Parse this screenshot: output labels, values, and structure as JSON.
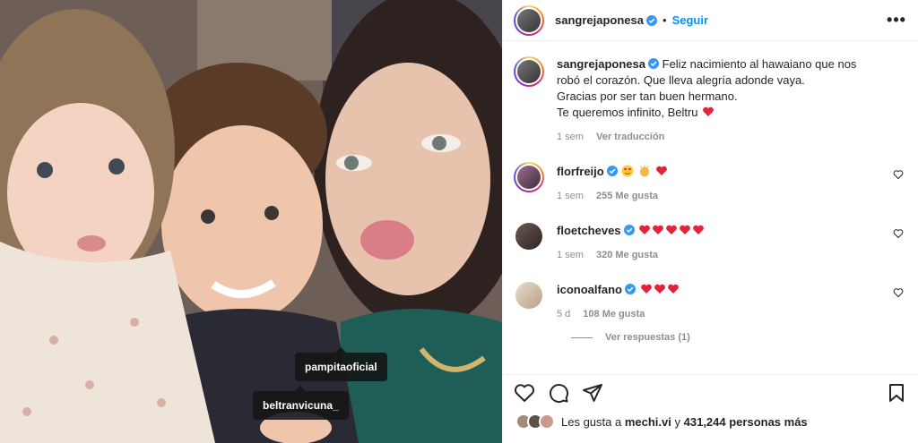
{
  "photo": {
    "tags": [
      "pampitaoficial",
      "beltranvicuna_"
    ]
  },
  "header": {
    "username": "sangrejaponesa",
    "dot": "•",
    "follow_label": "Seguir",
    "more_label": "•••"
  },
  "caption": {
    "username": "sangrejaponesa",
    "lines": [
      "Feliz nacimiento al hawaiano que nos robó el corazón. Que lleva alegría adonde vaya.",
      "Gracias por ser tan buen hermano.",
      "Te queremos infinito, Beltru"
    ],
    "time": "1 sem",
    "translate_label": "Ver traducción"
  },
  "comments": [
    {
      "username": "florfreijo",
      "time": "1 sem",
      "likes": "255 Me gusta"
    },
    {
      "username": "floetcheves",
      "time": "1 sem",
      "likes": "320 Me gusta"
    },
    {
      "username": "iconoalfano",
      "time": "5 d",
      "likes": "108 Me gusta"
    }
  ],
  "view_replies_label": "Ver respuestas (1)",
  "likes_summary": {
    "prefix": "Les gusta a",
    "user": "mechi.vi",
    "connector": "y",
    "count": "431,244 personas más"
  },
  "colors": {
    "accent": "#0095f6",
    "verified": "#3897f0",
    "heart": "#ed4956"
  },
  "icons": [
    "more-icon",
    "verified-icon",
    "heart-icon",
    "comment-icon",
    "share-icon",
    "bookmark-icon",
    "heart-emoji-icon",
    "heart-eyes-emoji-icon",
    "clap-emoji-icon"
  ]
}
